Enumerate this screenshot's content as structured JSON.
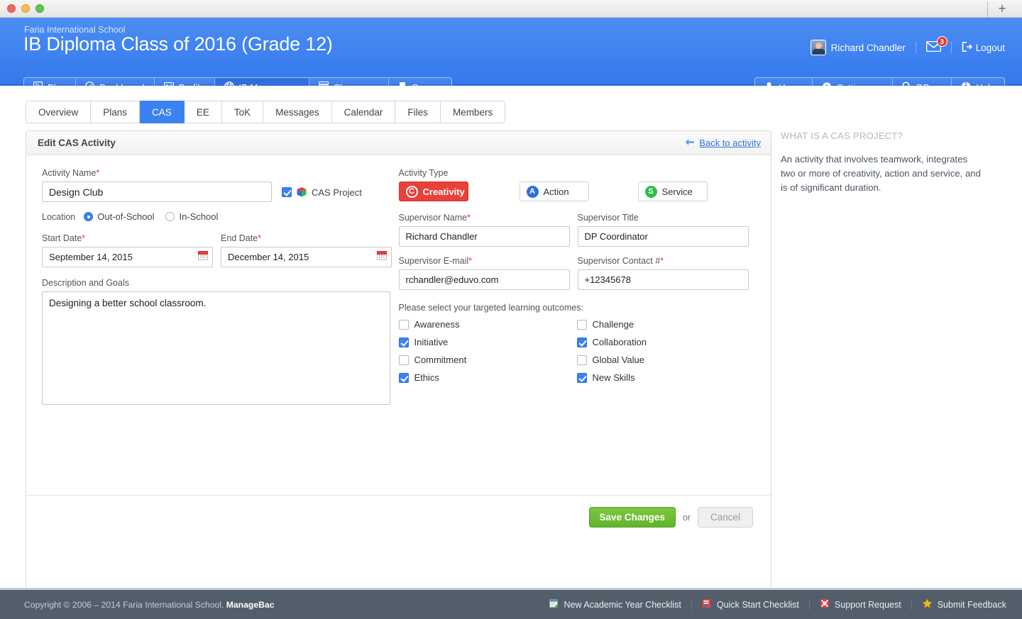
{
  "browser": {
    "new_tab_label": "+"
  },
  "header": {
    "school": "Faria International School",
    "title": "IB Diploma Class of 2016 (Grade 12)",
    "user_name": "Richard Chandler",
    "message_badge": "3",
    "logout_label": "Logout",
    "nav_left": [
      {
        "label": "Blog",
        "icon": "blog-icon",
        "active": false,
        "caret": false
      },
      {
        "label": "Dashboard",
        "icon": "dashboard-icon",
        "active": false,
        "caret": false
      },
      {
        "label": "Profile",
        "icon": "profile-icon",
        "active": false,
        "caret": false
      },
      {
        "label": "IB Manager",
        "icon": "globe-icon",
        "active": true,
        "caret": true
      },
      {
        "label": "Classes",
        "icon": "classes-icon",
        "active": false,
        "caret": true
      },
      {
        "label": "Groups",
        "icon": "groups-icon",
        "active": false,
        "caret": false
      }
    ],
    "nav_right": [
      {
        "label": "Users",
        "icon": "user-icon",
        "caret": false
      },
      {
        "label": "Settings",
        "icon": "gear-icon",
        "caret": true
      },
      {
        "label": "DP",
        "icon": "search-icon",
        "caret": true
      },
      {
        "label": "Help",
        "icon": "help-icon",
        "caret": false
      }
    ],
    "accent_blue": "#3b82f0",
    "active_blue": "#2f6fdc"
  },
  "tabs": [
    {
      "label": "Overview",
      "active": false
    },
    {
      "label": "Plans",
      "active": false
    },
    {
      "label": "CAS",
      "active": true
    },
    {
      "label": "EE",
      "active": false
    },
    {
      "label": "ToK",
      "active": false
    },
    {
      "label": "Messages",
      "active": false
    },
    {
      "label": "Calendar",
      "active": false
    },
    {
      "label": "Files",
      "active": false
    },
    {
      "label": "Members",
      "active": false
    }
  ],
  "panel": {
    "title": "Edit CAS Activity",
    "back_link": "Back to activity"
  },
  "form": {
    "activity_name_label": "Activity Name",
    "activity_name_value": "Design Club",
    "activity_name_placeholder": "Activity Name",
    "cas_project_label": "CAS Project",
    "cas_project_checked": true,
    "location_label": "Location",
    "location_options": [
      {
        "label": "Out-of-School",
        "selected": true
      },
      {
        "label": "In-School",
        "selected": false
      }
    ],
    "start_date_label": "Start Date",
    "start_date_value": "September 14, 2015",
    "end_date_label": "End Date",
    "end_date_value": "December 14, 2015",
    "description_label": "Description and Goals",
    "description_value": "Designing a better school classroom.",
    "description_placeholder": "Description and Goals",
    "activity_type_label": "Activity Type",
    "activity_types": [
      {
        "label": "Creativity",
        "badge": "C",
        "color": "#e8403a",
        "selected": true
      },
      {
        "label": "Action",
        "badge": "A",
        "color": "#2f6fdc",
        "selected": false
      },
      {
        "label": "Service",
        "badge": "S",
        "color": "#2dbd4e",
        "selected": false
      }
    ],
    "supervisor_name_label": "Supervisor Name",
    "supervisor_name_value": "Richard Chandler",
    "supervisor_title_label": "Supervisor Title",
    "supervisor_title_value": "DP Coordinator",
    "supervisor_email_label": "Supervisor E-mail",
    "supervisor_email_value": "rchandler@eduvo.com",
    "supervisor_contact_label": "Supervisor Contact #",
    "supervisor_contact_value": "+12345678",
    "outcomes_title": "Please select your targeted learning outcomes:",
    "outcomes": [
      {
        "label": "Awareness",
        "checked": false
      },
      {
        "label": "Challenge",
        "checked": false
      },
      {
        "label": "Initiative",
        "checked": true
      },
      {
        "label": "Collaboration",
        "checked": true
      },
      {
        "label": "Commitment",
        "checked": false
      },
      {
        "label": "Global Value",
        "checked": false
      },
      {
        "label": "Ethics",
        "checked": true
      },
      {
        "label": "New Skills",
        "checked": true
      }
    ],
    "save_label": "Save Changes",
    "or_label": "or",
    "cancel_label": "Cancel"
  },
  "aside": {
    "title": "WHAT IS A CAS PROJECT?",
    "body": "An activity that involves teamwork, integrates two or more of creativity, action and service, and is of significant duration."
  },
  "footer": {
    "copyright_prefix": "Copyright © 2006 – 2014 Faria International School.",
    "brand": "ManageBac",
    "links": [
      {
        "label": "New Academic Year Checklist",
        "icon": "calendar-add-icon"
      },
      {
        "label": "Quick Start Checklist",
        "icon": "checklist-icon"
      },
      {
        "label": "Support Request",
        "icon": "lifebuoy-icon"
      },
      {
        "label": "Submit Feedback",
        "icon": "star-icon"
      }
    ]
  }
}
